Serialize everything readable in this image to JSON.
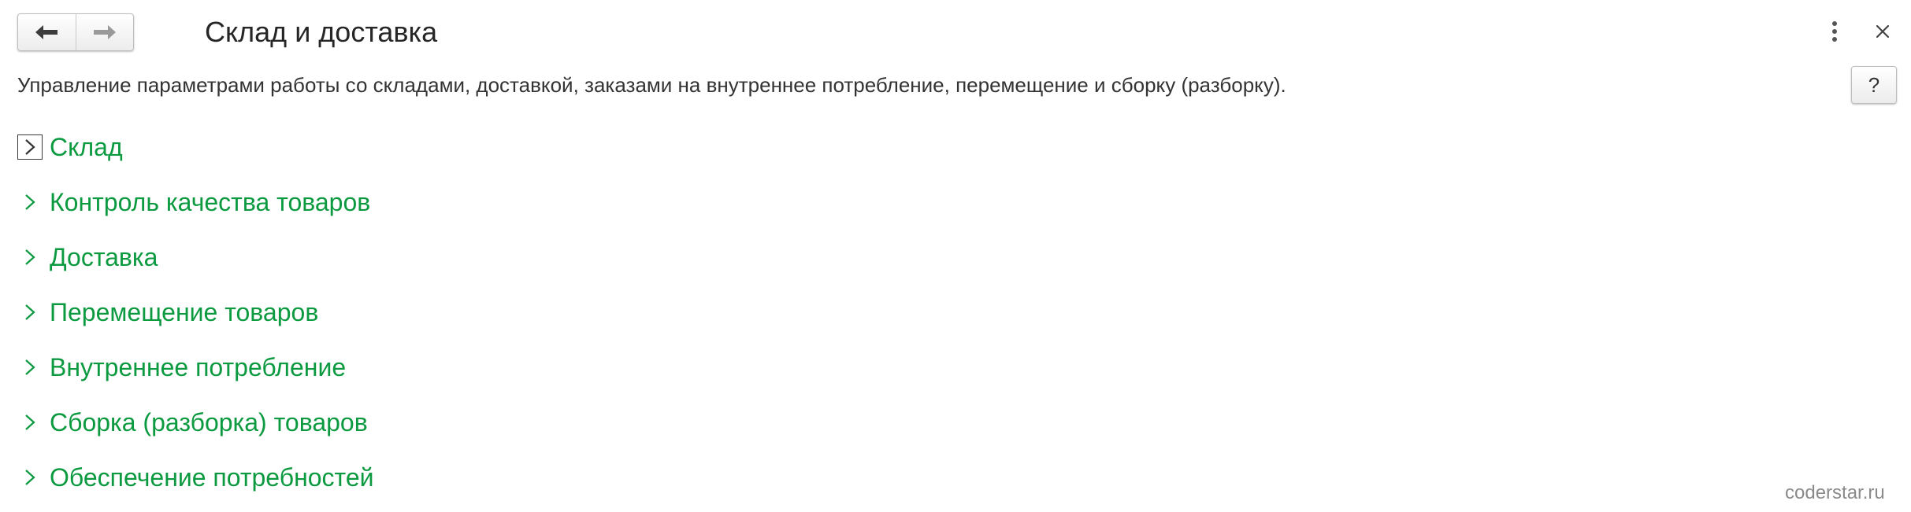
{
  "header": {
    "title": "Склад и доставка",
    "back_icon": "arrow-left-icon",
    "forward_icon": "arrow-right-icon",
    "more_icon": "vertical-dots-icon",
    "close_icon": "close-icon"
  },
  "description": "Управление параметрами работы со складами, доставкой, заказами на внутреннее потребление, перемещение и сборку (разборку).",
  "help_label": "?",
  "sections": [
    {
      "label": "Склад",
      "expanded": false,
      "focused": true
    },
    {
      "label": "Контроль качества товаров",
      "expanded": false
    },
    {
      "label": "Доставка",
      "expanded": false
    },
    {
      "label": "Перемещение товаров",
      "expanded": false
    },
    {
      "label": "Внутреннее потребление",
      "expanded": false
    },
    {
      "label": "Сборка (разборка) товаров",
      "expanded": false
    },
    {
      "label": "Обеспечение потребностей",
      "expanded": false
    }
  ],
  "watermark": "coderstar.ru",
  "colors": {
    "section_link": "#0c9a40",
    "text": "#333333",
    "title": "#262626",
    "watermark": "#8a8a8a"
  }
}
